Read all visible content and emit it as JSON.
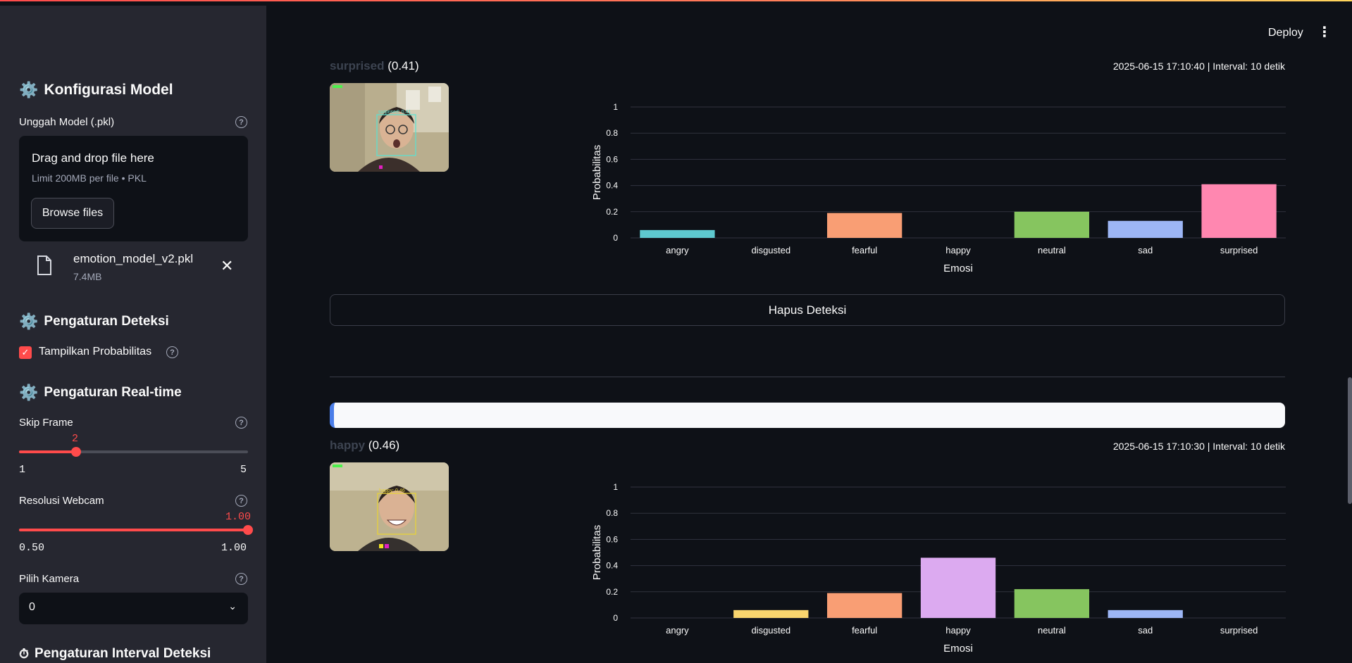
{
  "sidebar": {
    "model_config": {
      "title": "Konfigurasi Model",
      "upload_label": "Unggah Model (.pkl)",
      "dropzone_title": "Drag and drop file here",
      "dropzone_sub": "Limit 200MB per file • PKL",
      "browse_label": "Browse files",
      "file_name": "emotion_model_v2.pkl",
      "file_size": "7.4MB"
    },
    "detection_settings": {
      "title": "Pengaturan Deteksi",
      "show_prob_label": "Tampilkan Probabilitas",
      "show_prob_checked": true
    },
    "realtime_settings": {
      "title": "Pengaturan Real-time",
      "skip_frame": {
        "label": "Skip Frame",
        "value": "2",
        "min": "1",
        "max": "5",
        "fraction": 0.25
      },
      "resolution": {
        "label": "Resolusi Webcam",
        "value": "1.00",
        "min": "0.50",
        "max": "1.00",
        "fraction": 1.0
      },
      "camera": {
        "label": "Pilih Kamera",
        "value": "0"
      }
    },
    "interval_settings": {
      "title": "Pengaturan Interval Deteksi"
    }
  },
  "header": {
    "deploy_label": "Deploy"
  },
  "detections": [
    {
      "emotion": "surprised",
      "prob": "(0.41)",
      "timestamp": "2025-06-15 17:10:40 | Interval: 10 detik",
      "face_label": "surprised: 0.41"
    },
    {
      "emotion": "happy",
      "prob": "(0.46)",
      "timestamp": "2025-06-15 17:10:30 | Interval: 10 detik",
      "face_label": "happy: 0.46"
    }
  ],
  "clear_button_label": "Hapus Deteksi",
  "colors": {
    "angry": "#5ec8cf",
    "disgusted": "#f9d56e",
    "fearful": "#f99e74",
    "happy": "#dcaaf0",
    "neutral": "#86c55f",
    "sad": "#9db6f5",
    "surprised": "#ff87b0",
    "accent": "#ff4b4b"
  },
  "chart_data": [
    {
      "type": "bar",
      "categories": [
        "angry",
        "disgusted",
        "fearful",
        "happy",
        "neutral",
        "sad",
        "surprised"
      ],
      "values": [
        0.06,
        0.0,
        0.19,
        0.0,
        0.2,
        0.13,
        0.41
      ],
      "xlabel": "Emosi",
      "ylabel": "Probabilitas",
      "ylim": [
        0,
        1
      ],
      "yticks": [
        "0",
        "0.2",
        "0.4",
        "0.6",
        "0.8",
        "1"
      ],
      "grid": true
    },
    {
      "type": "bar",
      "categories": [
        "angry",
        "disgusted",
        "fearful",
        "happy",
        "neutral",
        "sad",
        "surprised"
      ],
      "values": [
        0.0,
        0.06,
        0.19,
        0.46,
        0.22,
        0.06,
        0.0
      ],
      "xlabel": "Emosi",
      "ylabel": "Probabilitas",
      "ylim": [
        0,
        1
      ],
      "yticks": [
        "0",
        "0.2",
        "0.4",
        "0.6",
        "0.8",
        "1"
      ],
      "grid": true
    }
  ]
}
